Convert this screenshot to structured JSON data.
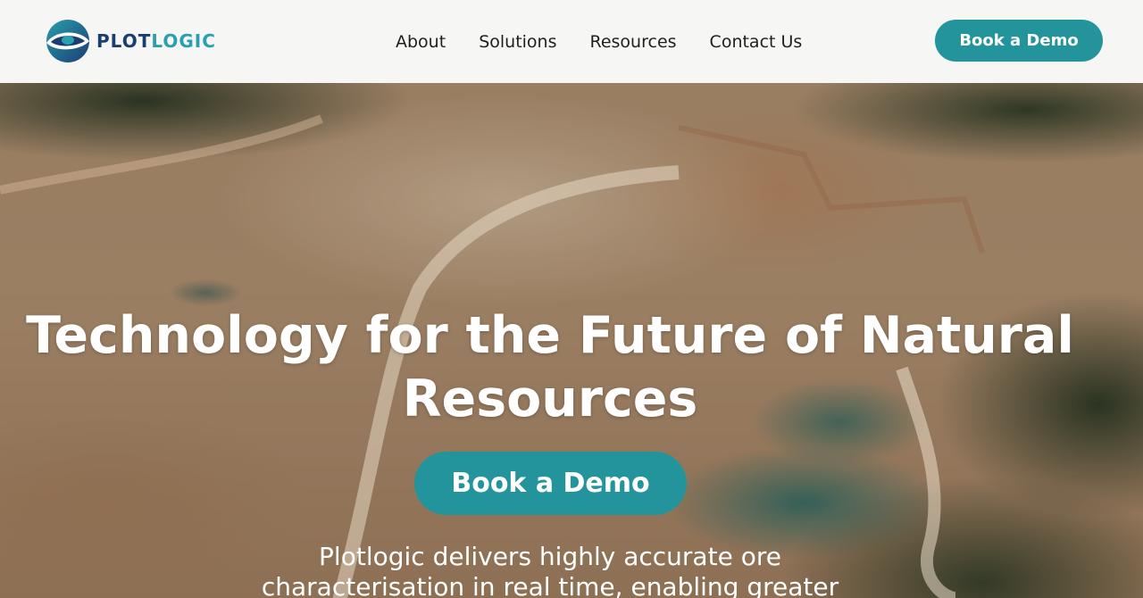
{
  "header": {
    "logo_text_primary": "PLOT",
    "logo_text_accent": "LOGIC",
    "nav": [
      {
        "label": "About"
      },
      {
        "label": "Solutions"
      },
      {
        "label": "Resources"
      },
      {
        "label": "Contact Us"
      }
    ],
    "cta_label": "Book a Demo"
  },
  "hero": {
    "title": "Technology for the Future of Natural Resources",
    "cta_label": "Book a Demo",
    "subtitle": "Plotlogic delivers highly accurate ore characterisation in real time, enabling greater"
  },
  "colors": {
    "accent": "#24949c",
    "brand_navy": "#1a3d73",
    "brand_teal": "#2a9fae"
  },
  "icons": {
    "logo": "plotlogic-eye-logo"
  }
}
